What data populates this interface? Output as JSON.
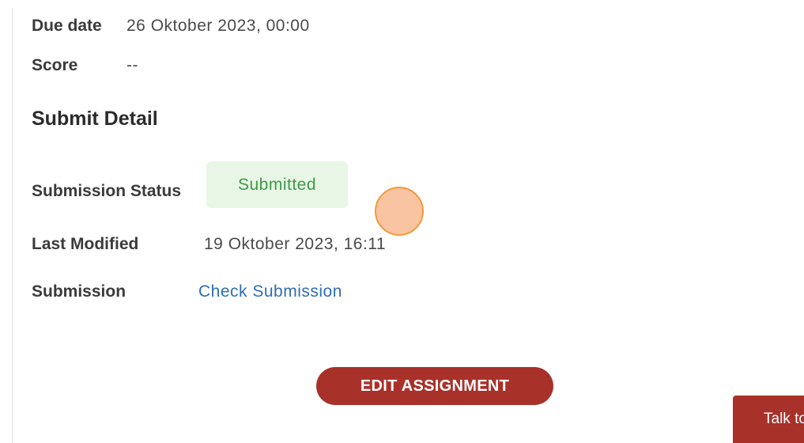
{
  "details": {
    "due_date_label": "Due date",
    "due_date_value": "26 Oktober 2023, 00:00",
    "score_label": "Score",
    "score_value": "--"
  },
  "submit_detail": {
    "title": "Submit Detail",
    "status_label": "Submission Status",
    "status_value": "Submitted",
    "last_modified_label": "Last Modified",
    "last_modified_value": "19 Oktober 2023, 16:11",
    "submission_label": "Submission",
    "submission_link": "Check Submission"
  },
  "actions": {
    "edit_label": "EDIT ASSIGNMENT"
  },
  "chat": {
    "label": "Talk to us",
    "icon": "chat-bubble-icon"
  },
  "colors": {
    "brand": "#a8312a",
    "success_bg": "#e8f6e6",
    "success_text": "#3c9a47",
    "link": "#2f6db3"
  }
}
